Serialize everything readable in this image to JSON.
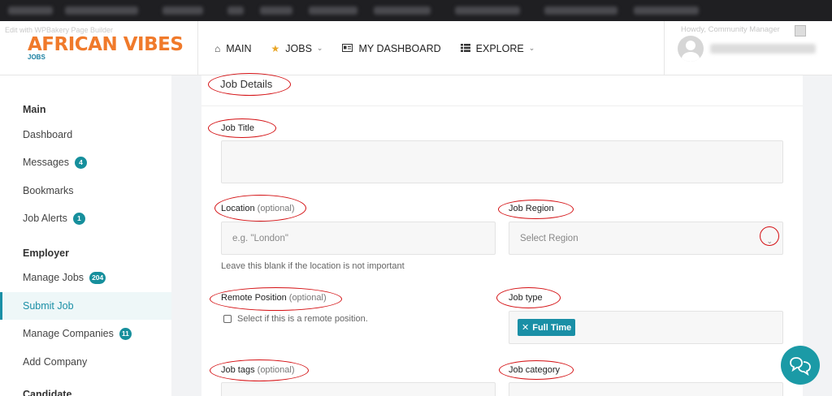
{
  "header": {
    "edit_with": "Edit with WPBakery Page Builder",
    "logo_main": "AFRICAN VIBES",
    "logo_sub": "JOBS",
    "nav": [
      {
        "label": "MAIN",
        "icon": "home-icon"
      },
      {
        "label": "JOBS",
        "icon": "star-icon"
      },
      {
        "label": "MY DASHBOARD",
        "icon": "id-card-icon"
      },
      {
        "label": "EXPLORE",
        "icon": "list-icon"
      }
    ],
    "howdy": "Howdy, Community Manager"
  },
  "sidebar": {
    "sections": [
      "Main",
      "Employer",
      "Candidate"
    ],
    "items": [
      {
        "label": "Dashboard",
        "badge": ""
      },
      {
        "label": "Messages",
        "badge": "4"
      },
      {
        "label": "Bookmarks",
        "badge": ""
      },
      {
        "label": "Job Alerts",
        "badge": "1"
      },
      {
        "label": "Manage Jobs",
        "badge": "204"
      },
      {
        "label": "Submit Job",
        "badge": ""
      },
      {
        "label": "Manage Companies",
        "badge": "11"
      },
      {
        "label": "Add Company",
        "badge": ""
      }
    ],
    "active": "Submit Job"
  },
  "form": {
    "title": "Job Details",
    "job_title": {
      "label": "Job Title",
      "value": ""
    },
    "location": {
      "label": "Location",
      "optional": "(optional)",
      "placeholder": "e.g. \"London\"",
      "helper": "Leave this blank if the location is not important"
    },
    "job_region": {
      "label": "Job Region",
      "placeholder": "Select Region"
    },
    "remote": {
      "label": "Remote Position",
      "optional": "(optional)",
      "checkbox_label": "Select if this is a remote position."
    },
    "job_type": {
      "label": "Job type",
      "selected": "Full Time"
    },
    "job_tags": {
      "label": "Job tags",
      "optional": "(optional)"
    },
    "job_category": {
      "label": "Job category"
    }
  },
  "colors": {
    "accent": "#1a8fa6",
    "annotation": "#d40f12",
    "logo": "#f07a2b"
  }
}
